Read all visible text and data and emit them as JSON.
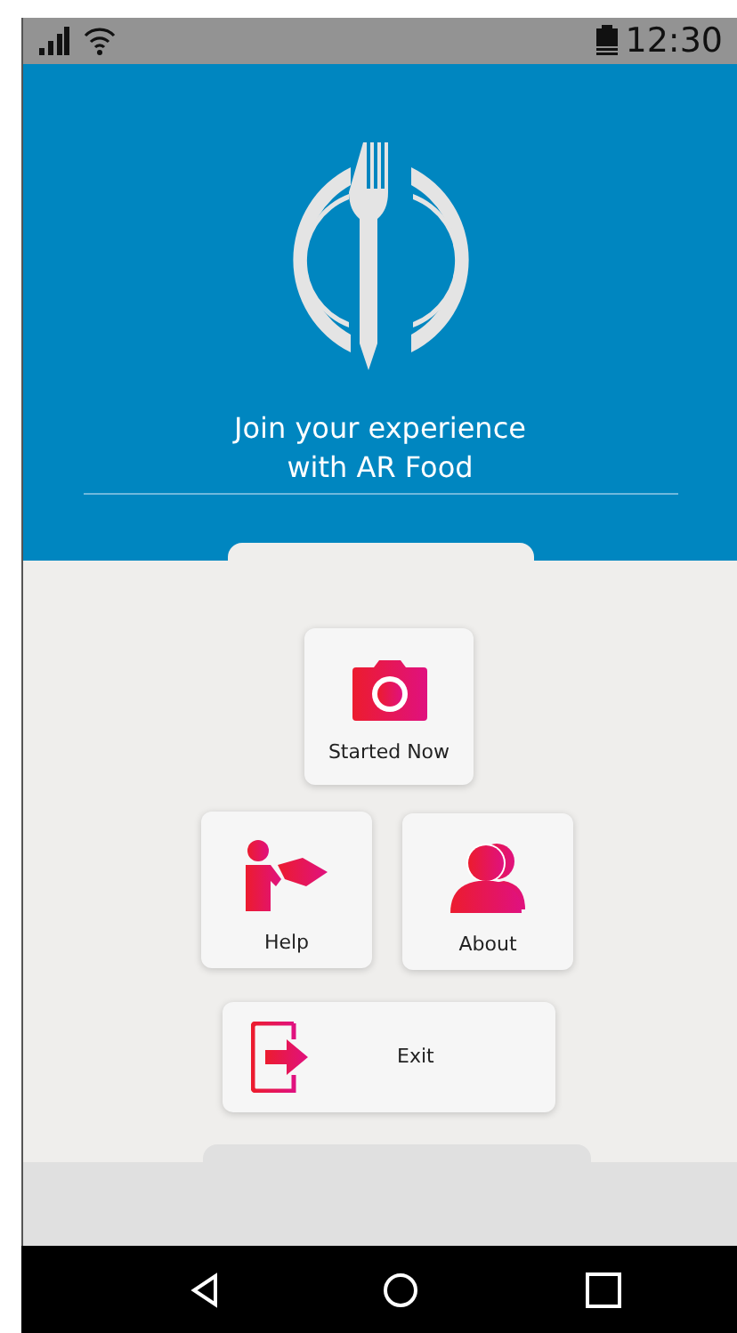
{
  "status_bar": {
    "time": "12:30"
  },
  "header": {
    "title": "Join your experience with AR Food"
  },
  "menu": [
    {
      "kind": "camera",
      "label": "Started Now"
    },
    {
      "kind": "help",
      "label": "Help"
    },
    {
      "kind": "about",
      "label": "About"
    },
    {
      "kind": "exit",
      "label": "Exit"
    }
  ]
}
